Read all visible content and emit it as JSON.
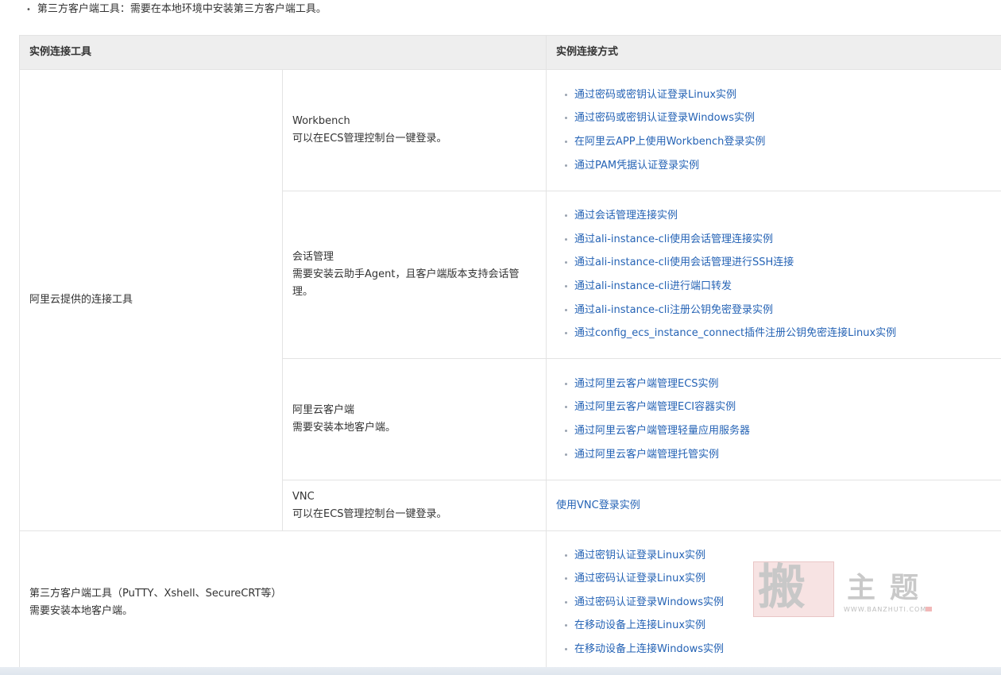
{
  "intro": {
    "bullet": "•",
    "text": "第三方客户端工具：需要在本地环境中安装第三方客户端工具。"
  },
  "table": {
    "headers": [
      "实例连接工具",
      "实例连接方式"
    ],
    "group1_label": "阿里云提供的连接工具",
    "rows": [
      {
        "tool_name": "Workbench",
        "tool_desc": "可以在ECS管理控制台一键登录。",
        "methods": [
          "通过密码或密钥认证登录Linux实例",
          "通过密码或密钥认证登录Windows实例",
          "在阿里云APP上使用Workbench登录实例",
          "通过PAM凭据认证登录实例"
        ]
      },
      {
        "tool_name": "会话管理",
        "tool_desc": "需要安装云助手Agent，且客户端版本支持会话管理。",
        "methods": [
          "通过会话管理连接实例",
          "通过ali-instance-cli使用会话管理连接实例",
          "通过ali-instance-cli使用会话管理进行SSH连接",
          "通过ali-instance-cli进行端口转发",
          "通过ali-instance-cli注册公钥免密登录实例",
          "通过config_ecs_instance_connect插件注册公钥免密连接Linux实例"
        ]
      },
      {
        "tool_name": "阿里云客户端",
        "tool_desc": "需要安装本地客户端。",
        "methods": [
          "通过阿里云客户端管理ECS实例",
          "通过阿里云客户端管理ECI容器实例",
          "通过阿里云客户端管理轻量应用服务器",
          "通过阿里云客户端管理托管实例"
        ]
      },
      {
        "tool_name": "VNC",
        "tool_desc": "可以在ECS管理控制台一键登录。",
        "single_method": "使用VNC登录实例"
      }
    ],
    "third_party": {
      "tool_name": "第三方客户端工具（PuTTY、Xshell、SecureCRT等）",
      "tool_desc": "需要安装本地客户端。",
      "methods": [
        "通过密钥认证登录Linux实例",
        "通过密码认证登录Linux实例",
        "通过密码认证登录Windows实例",
        "在移动设备上连接Linux实例",
        "在移动设备上连接Windows实例"
      ]
    }
  },
  "watermark": {
    "glyph": "搬",
    "text": "主题",
    "url": "WWW.BANZHUTI.COM"
  },
  "colors": {
    "link": "#2563b5",
    "header_bg": "#eeeeee",
    "border": "#e3e3e3",
    "text": "#333333"
  }
}
